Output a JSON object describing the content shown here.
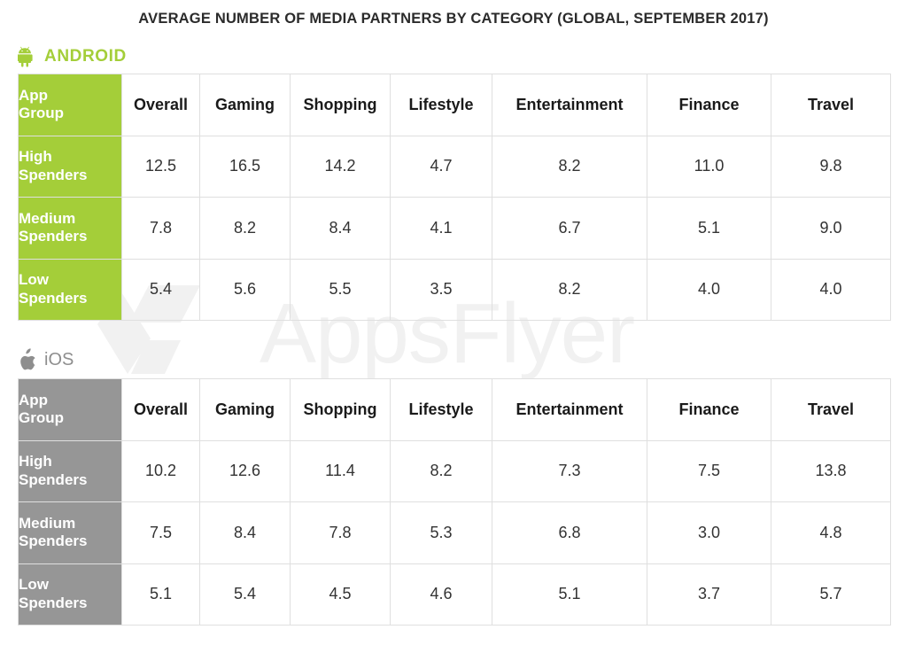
{
  "title": "AVERAGE NUMBER OF MEDIA PARTNERS BY CATEGORY (GLOBAL, SEPTEMBER 2017)",
  "watermark": {
    "text": "AppsFlyer"
  },
  "colors": {
    "android_green": "#A4CE39",
    "ios_gray": "#969696",
    "text": "#333333",
    "border": "#DFDFDF",
    "watermark": "#F1F1F1"
  },
  "platforms": [
    {
      "id": "android",
      "label": "ANDROID",
      "icon": "android-icon",
      "columns": [
        "App Group",
        "Overall",
        "Gaming",
        "Shopping",
        "Lifestyle",
        "Entertainment",
        "Finance",
        "Travel"
      ],
      "group_header_line1": "App",
      "group_header_line2": "Group",
      "rows": [
        {
          "group_line1": "High",
          "group_line2": "Spenders",
          "values": [
            "12.5",
            "16.5",
            "14.2",
            "4.7",
            "8.2",
            "11.0",
            "9.8"
          ]
        },
        {
          "group_line1": "Medium",
          "group_line2": "Spenders",
          "values": [
            "7.8",
            "8.2",
            "8.4",
            "4.1",
            "6.7",
            "5.1",
            "9.0"
          ]
        },
        {
          "group_line1": "Low",
          "group_line2": "Spenders",
          "values": [
            "5.4",
            "5.6",
            "5.5",
            "3.5",
            "8.2",
            "4.0",
            "4.0"
          ]
        }
      ]
    },
    {
      "id": "ios",
      "label": "iOS",
      "icon": "apple-icon",
      "columns": [
        "App Group",
        "Overall",
        "Gaming",
        "Shopping",
        "Lifestyle",
        "Entertainment",
        "Finance",
        "Travel"
      ],
      "group_header_line1": "App",
      "group_header_line2": "Group",
      "rows": [
        {
          "group_line1": "High",
          "group_line2": "Spenders",
          "values": [
            "10.2",
            "12.6",
            "11.4",
            "8.2",
            "7.3",
            "7.5",
            "13.8"
          ]
        },
        {
          "group_line1": "Medium",
          "group_line2": "Spenders",
          "values": [
            "7.5",
            "8.4",
            "7.8",
            "5.3",
            "6.8",
            "3.0",
            "4.8"
          ]
        },
        {
          "group_line1": "Low",
          "group_line2": "Spenders",
          "values": [
            "5.1",
            "5.4",
            "4.5",
            "4.6",
            "5.1",
            "3.7",
            "5.7"
          ]
        }
      ]
    }
  ],
  "chart_data": {
    "type": "table",
    "title": "AVERAGE NUMBER OF MEDIA PARTNERS BY CATEGORY (GLOBAL, SEPTEMBER 2017)",
    "xlabel": "",
    "ylabel": "Average number of media partners",
    "categories": [
      "Overall",
      "Gaming",
      "Shopping",
      "Lifestyle",
      "Entertainment",
      "Finance",
      "Travel"
    ],
    "tables": [
      {
        "name": "Android",
        "row_label": "App Group",
        "rows": [
          "High Spenders",
          "Medium Spenders",
          "Low Spenders"
        ],
        "series": [
          {
            "name": "High Spenders",
            "values": [
              12.5,
              16.5,
              14.2,
              4.7,
              8.2,
              11.0,
              9.8
            ]
          },
          {
            "name": "Medium Spenders",
            "values": [
              7.8,
              8.2,
              8.4,
              4.1,
              6.7,
              5.1,
              9.0
            ]
          },
          {
            "name": "Low Spenders",
            "values": [
              5.4,
              5.6,
              5.5,
              3.5,
              8.2,
              4.0,
              4.0
            ]
          }
        ]
      },
      {
        "name": "iOS",
        "row_label": "App Group",
        "rows": [
          "High Spenders",
          "Medium Spenders",
          "Low Spenders"
        ],
        "series": [
          {
            "name": "High Spenders",
            "values": [
              10.2,
              12.6,
              11.4,
              8.2,
              7.3,
              7.5,
              13.8
            ]
          },
          {
            "name": "Medium Spenders",
            "values": [
              7.5,
              8.4,
              7.8,
              5.3,
              6.8,
              3.0,
              4.8
            ]
          },
          {
            "name": "Low Spenders",
            "values": [
              5.1,
              5.4,
              4.5,
              4.6,
              5.1,
              3.7,
              5.7
            ]
          }
        ]
      }
    ]
  }
}
